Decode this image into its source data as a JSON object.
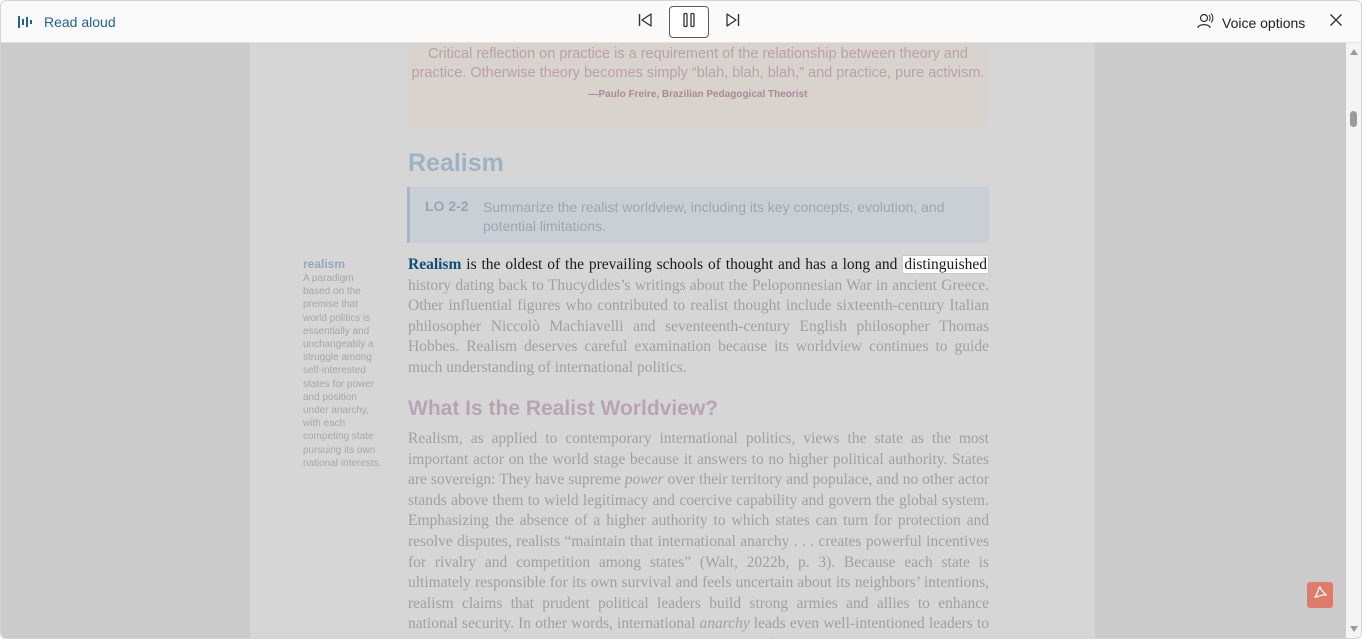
{
  "toolbar": {
    "read_aloud_label": "Read aloud",
    "voice_options_label": "Voice options"
  },
  "document": {
    "quote_text": "Critical reflection on practice is a requirement of the relationship between theory and practice. Otherwise theory becomes simply “blah, blah, blah,” and practice, pure activism.",
    "quote_attribution": "—Paulo Freire, Brazilian Pedagogical Theorist",
    "heading_realism": "Realism",
    "lo_tag": "LO 2-2",
    "lo_text": "Summarize the realist worldview, including its key concepts, evolution, and potential limitations.",
    "margin_term": "realism",
    "margin_definition": "A paradigm based on the premise that world politics is essentially and unchangeably a struggle among self-interested states for power and position under anarchy, with each competing state pursuing its own national interests.",
    "p1_keyword": "Realism",
    "p1_read": " is the oldest of the prevailing schools of thought and has a long and ",
    "p1_highlight": "distinguished",
    "p1_rest": " history dating back to Thucydides’s writings about the Peloponnesian War in ancient Greece. Other influential figures who contributed to realist thought include sixteenth-century Italian philosopher Niccolò Machiavelli and seventeenth-century English philosopher Thomas Hobbes. Realism deserves careful examination because its worldview continues to guide much understanding of international politics.",
    "heading_worldview": "What Is the Realist Worldview?",
    "p2_a": "Realism, as applied to contemporary international politics, views the state as the most important actor on the world stage because it answers to no higher political authority. States are sovereign: They have supreme ",
    "p2_power": "power",
    "p2_b": " over their territory and populace, and no other actor stands above them to wield legitimacy and coercive capability and govern the global system. Emphasizing the absence of a higher authority to which states can turn for protection and resolve disputes, realists “maintain that international anarchy . . . creates powerful incentives for rivalry and competition among states” (Walt, 2022b, p. 3). Because each state is ultimately responsible for its own survival and feels uncertain about its neighbors’ intentions, realism claims that prudent political leaders build strong armies and allies to enhance national security. In other words, international ",
    "p2_anarchy": "anarchy",
    "p2_c": " leads even well-intentioned leaders to practice self-help, increase their own military strength, and"
  },
  "colors": {
    "accent": "#1f5fa8",
    "highlight_keyword": "#0e4f73",
    "pdf_badge": "#e07a6a"
  },
  "icons": {
    "read_aloud": "read-aloud-icon",
    "previous": "skip-previous-icon",
    "pause": "pause-icon",
    "next": "skip-next-icon",
    "voice": "voice-icon",
    "close": "close-icon",
    "pdf": "pdf-icon"
  }
}
